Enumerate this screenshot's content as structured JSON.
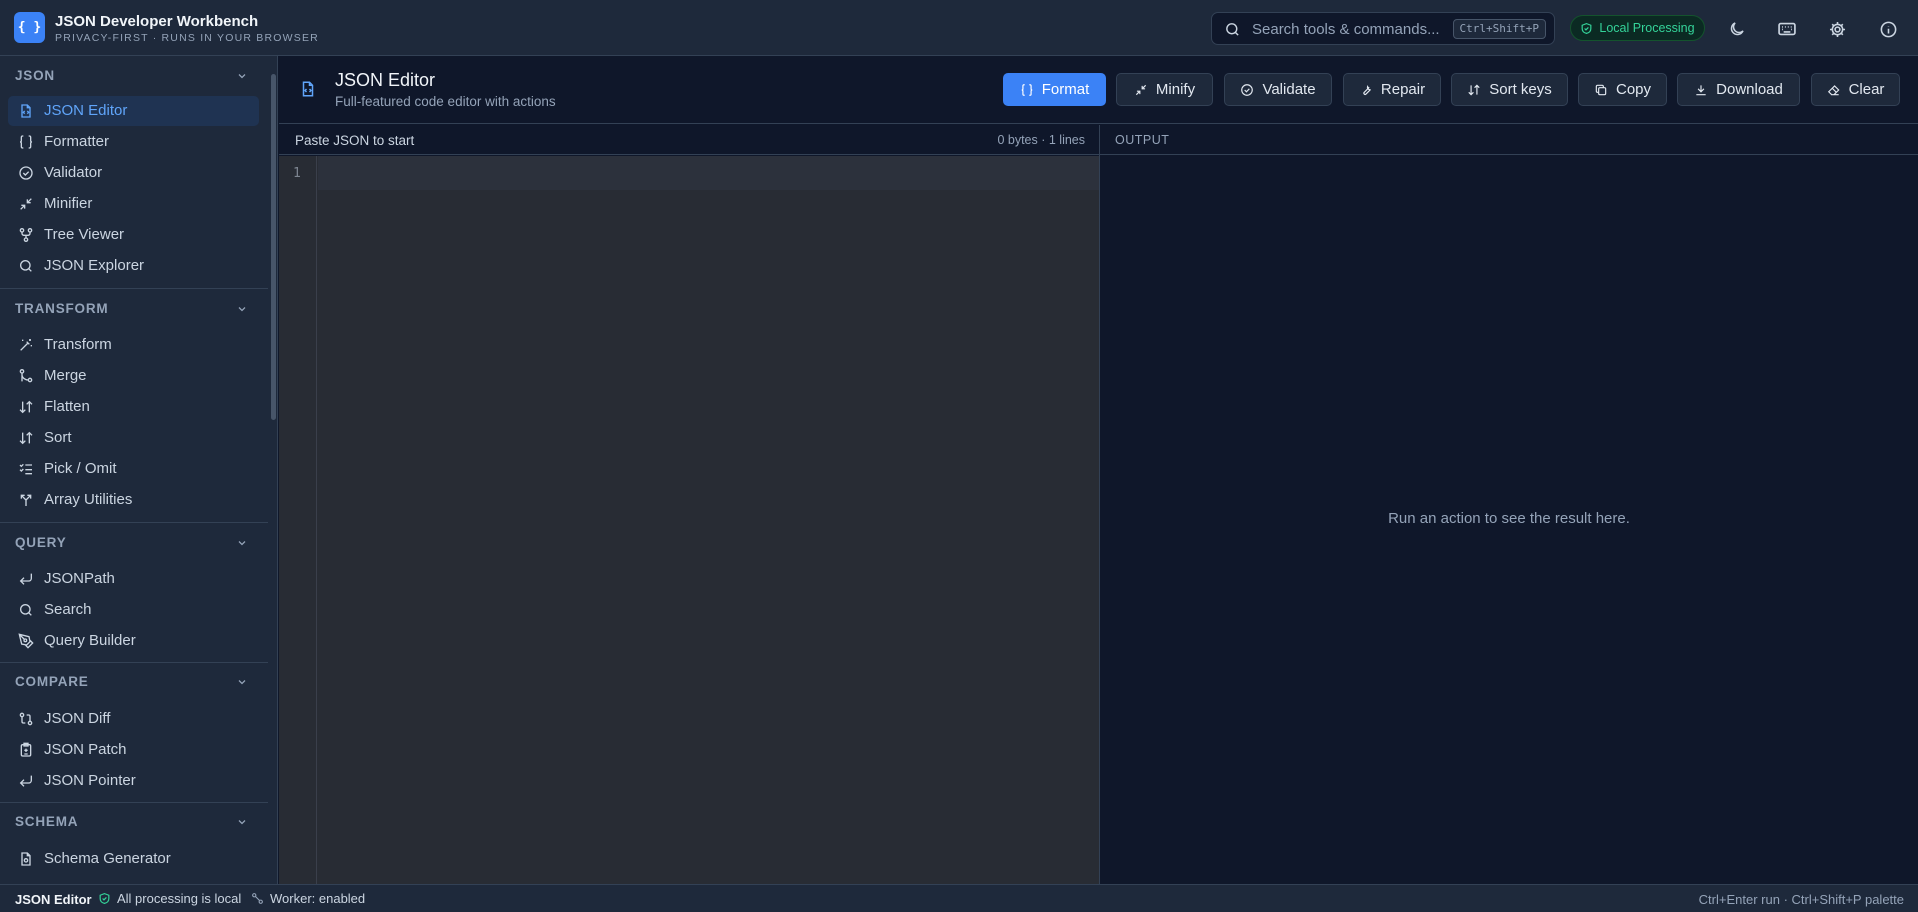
{
  "app": {
    "logo_glyph": "{ }",
    "title": "JSON Developer Workbench",
    "subtitle": "PRIVACY-FIRST · RUNS IN YOUR BROWSER"
  },
  "search": {
    "placeholder": "Search tools & commands...",
    "shortcut": "Ctrl+Shift+P"
  },
  "badge": {
    "label": "Local Processing",
    "color": "#34d399"
  },
  "sidebar": {
    "sections": [
      {
        "title": "JSON",
        "items": [
          "JSON Editor",
          "Formatter",
          "Validator",
          "Minifier",
          "Tree Viewer",
          "JSON Explorer"
        ]
      },
      {
        "title": "TRANSFORM",
        "items": [
          "Transform",
          "Merge",
          "Flatten",
          "Sort",
          "Pick / Omit",
          "Array Utilities"
        ]
      },
      {
        "title": "QUERY",
        "items": [
          "JSONPath",
          "Search",
          "Query Builder"
        ]
      },
      {
        "title": "COMPARE",
        "items": [
          "JSON Diff",
          "JSON Patch",
          "JSON Pointer"
        ]
      },
      {
        "title": "SCHEMA",
        "items": [
          "Schema Generator"
        ]
      }
    ],
    "active": "JSON Editor"
  },
  "tool": {
    "title": "JSON Editor",
    "subtitle": "Full-featured code editor with actions",
    "actions": [
      "Format",
      "Minify",
      "Validate",
      "Repair",
      "Sort keys",
      "Copy",
      "Download",
      "Clear"
    ]
  },
  "input": {
    "hint": "Paste JSON to start",
    "stats": "0 bytes · 1 lines",
    "line_number": "1"
  },
  "output": {
    "label": "OUTPUT",
    "empty": "Run an action to see the result here."
  },
  "status": {
    "tool": "JSON Editor",
    "local": "All processing is local",
    "worker": "Worker: enabled",
    "shortcuts": "Ctrl+Enter run · Ctrl+Shift+P palette"
  },
  "colors": {
    "accent": "#3b82f6",
    "background": "#0f172a",
    "panel": "#1e293b",
    "editor": "#282c34"
  }
}
